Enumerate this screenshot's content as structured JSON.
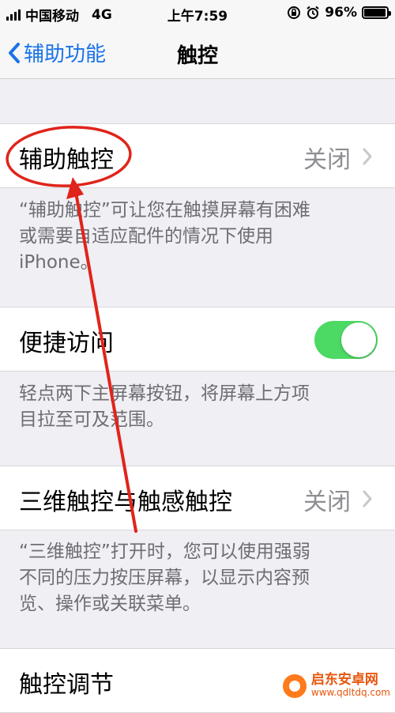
{
  "status_bar": {
    "carrier": "中国移动",
    "network": "4G",
    "time": "上午7:59",
    "battery_percent": "96%",
    "battery_level": 0.96
  },
  "nav": {
    "back_label": "辅助功能",
    "title": "触控"
  },
  "rows": [
    {
      "label": "辅助触控",
      "value": "关闭"
    },
    {
      "label": "便捷访问",
      "toggle_on": true
    },
    {
      "label": "三维触控与触感触控",
      "value": "关闭"
    },
    {
      "label": "触控调节"
    }
  ],
  "footers": [
    {
      "line1": "“辅助触控”可让您在触摸屏幕有困难",
      "line2": "或需要自适应配件的情况下使用",
      "line3": "iPhone。"
    },
    {
      "line1": "轻点两下主屏幕按钮，将屏幕上方项",
      "line2": "目拉至可及范围。"
    },
    {
      "line1": "“三维触控”打开时，您可以使用强弱",
      "line2": "不同的压力按压屏幕，以显示内容预",
      "line3": "览、操作或关联菜单。"
    }
  ],
  "watermark": {
    "title": "启东安卓网",
    "url": "www.qdltdq.com"
  },
  "colors": {
    "accent": "#1a73e8",
    "toggle_on": "#4cd964",
    "annotation": "#e0241b"
  }
}
